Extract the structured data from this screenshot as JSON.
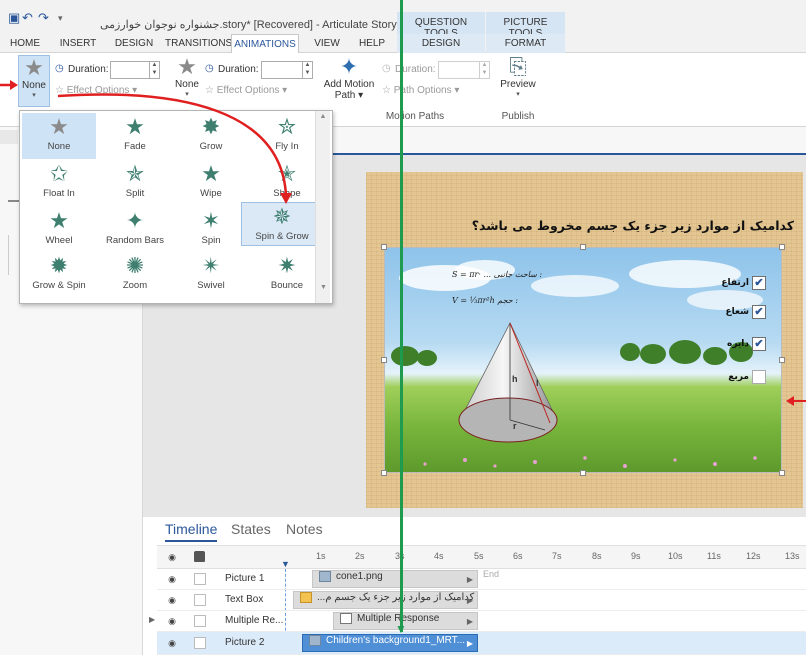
{
  "title": {
    "text": "جشنواره نوجوان خوارزمی.story* [Recovered] - Articulate Storyline 2",
    "ctx_question": "QUESTION TOOLS",
    "ctx_picture": "PICTURE TOOLS"
  },
  "tabs": {
    "home": "HOME",
    "insert": "INSERT",
    "design": "DESIGN",
    "transitions": "TRANSITIONS",
    "animations": "ANIMATIONS",
    "view": "VIEW",
    "help": "HELP",
    "q_design": "DESIGN",
    "format": "FORMAT"
  },
  "ribbon": {
    "entrance_label": "None",
    "duration_label": "Duration:",
    "effect_options": "Effect Options",
    "exit_label": "None",
    "exit_duration_label": "Duration:",
    "exit_effect_options": "Effect Options",
    "add_motion_path": "Add Motion Path",
    "motion_duration_label": "Duration:",
    "path_options": "Path Options",
    "motion_paths_group": "Motion Paths",
    "preview": "Preview",
    "publish_group": "Publish"
  },
  "gallery": {
    "items": [
      "None",
      "Fade",
      "Grow",
      "Fly In",
      "Float In",
      "Split",
      "Wipe",
      "Shape",
      "Wheel",
      "Random Bars",
      "Spin",
      "Spin & Grow",
      "Grow & Spin",
      "Zoom",
      "Swivel",
      "Bounce"
    ],
    "selected": "Spin & Grow"
  },
  "slide": {
    "question": "کدامیک از موارد زیر جزء یک جسم مخروط می باشد؟",
    "formula1": "S = πr· ... ساحت جانبی :",
    "formula2": "V = ⅓πr²h     حجم :",
    "label_h": "h",
    "label_l": "l",
    "label_r": "r",
    "options": [
      {
        "text": "ارتفاع",
        "checked": true
      },
      {
        "text": "شعاع",
        "checked": true
      },
      {
        "text": "دایره",
        "checked": true
      },
      {
        "text": "مربع",
        "checked": false
      }
    ]
  },
  "timeline": {
    "tabs": [
      "Timeline",
      "States",
      "Notes"
    ],
    "active_tab": "Timeline",
    "ticks": [
      "1s",
      "2s",
      "3s",
      "4s",
      "5s",
      "6s",
      "7s",
      "8s",
      "9s",
      "10s",
      "11s",
      "12s",
      "13s"
    ],
    "end_label": "End",
    "rows": [
      {
        "name": "Picture 1",
        "bar": "cone1.png"
      },
      {
        "name": "Text Box",
        "bar": "...کدامیک از موارد زیر جزء یک جسم م"
      },
      {
        "name": "Multiple Re...",
        "bar": "Multiple Response"
      },
      {
        "name": "Picture 2",
        "bar": "Children's background1_MRT..."
      }
    ]
  },
  "colors": {
    "accent": "#2b579a",
    "annotation_red": "#e02020",
    "annotation_green": "#1e9b4f",
    "selected_row": "#4f8fd6"
  },
  "icons": {
    "undo": "undo-icon",
    "redo": "redo-icon",
    "star": "animation-star-icon",
    "clock": "clock-icon",
    "preview": "preview-icon",
    "eye": "eye-icon",
    "lock": "lock-icon"
  }
}
